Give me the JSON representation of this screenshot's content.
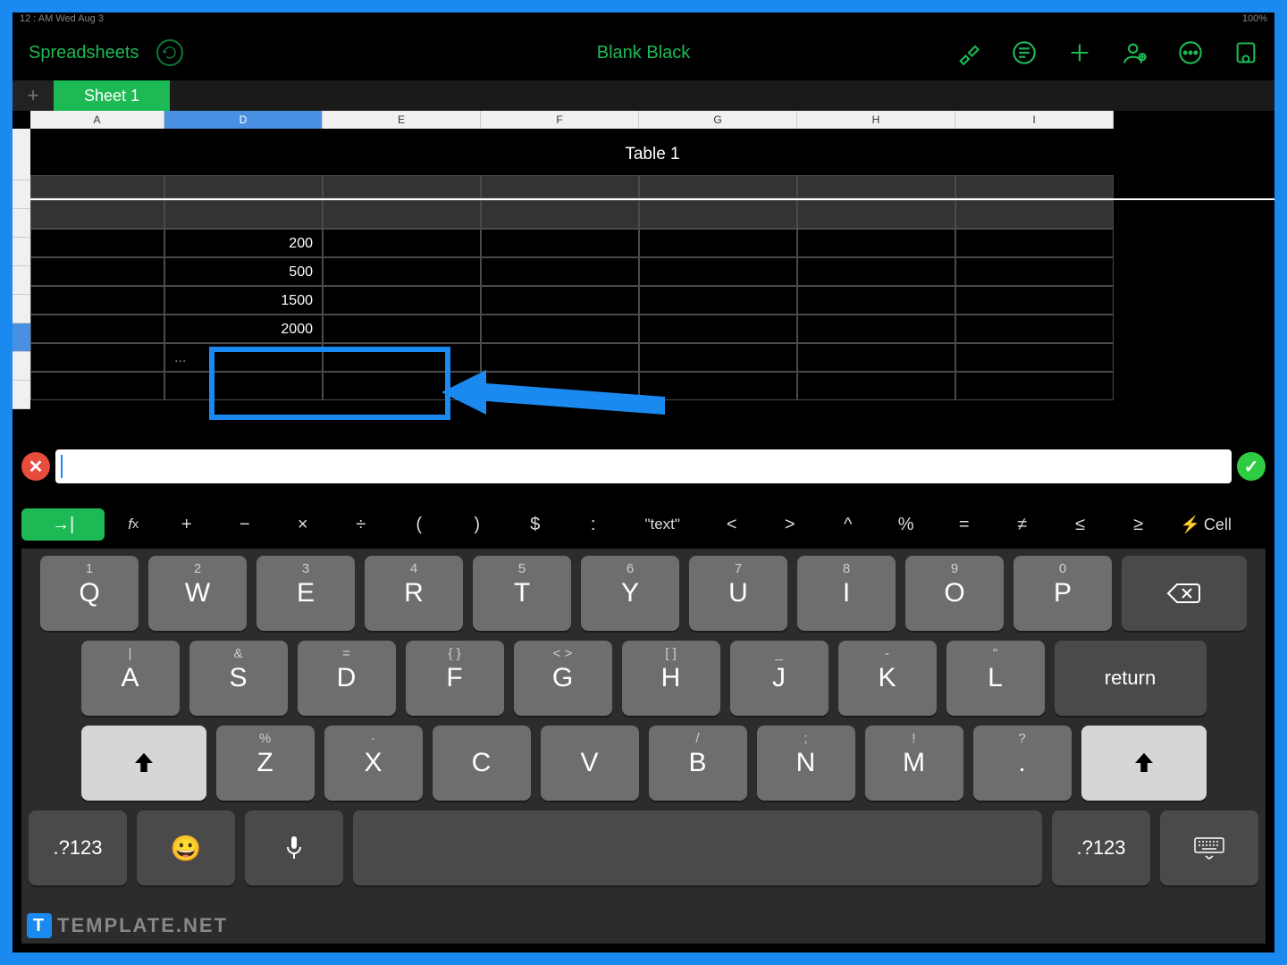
{
  "status": {
    "left": "12 : AM   Wed Aug 3",
    "right": "100%"
  },
  "toolbar": {
    "back": "Spreadsheets",
    "title": "Blank Black"
  },
  "tabs": {
    "active": "Sheet 1"
  },
  "columns": [
    "A",
    "D",
    "E",
    "F",
    "G",
    "H",
    "I"
  ],
  "selectedCol": 1,
  "selectedRow": 7,
  "table": {
    "title": "Table 1",
    "rows": [
      [
        "",
        "",
        "",
        "",
        "",
        "",
        ""
      ],
      [
        "",
        "",
        "",
        "",
        "",
        "",
        ""
      ],
      [
        "",
        "200",
        "",
        "",
        "",
        "",
        ""
      ],
      [
        "",
        "500",
        "",
        "",
        "",
        "",
        ""
      ],
      [
        "",
        "1500",
        "",
        "",
        "",
        "",
        ""
      ],
      [
        "",
        "2000",
        "",
        "",
        "",
        "",
        ""
      ],
      [
        "",
        "...",
        "",
        "",
        "",
        "",
        ""
      ],
      [
        "",
        "",
        "",
        "",
        "",
        "",
        ""
      ]
    ]
  },
  "formulaValue": "",
  "shortcuts": [
    "→|",
    "fx",
    "+",
    "−",
    "×",
    "÷",
    "(",
    ")",
    "$",
    ":",
    "\"text\"",
    "<",
    ">",
    "^",
    "%",
    "=",
    "≠",
    "≤",
    "≥"
  ],
  "shortcutCell": "⚡ Cell",
  "keyboard": {
    "row1": [
      {
        "m": "Q",
        "s": "1"
      },
      {
        "m": "W",
        "s": "2"
      },
      {
        "m": "E",
        "s": "3"
      },
      {
        "m": "R",
        "s": "4"
      },
      {
        "m": "T",
        "s": "5"
      },
      {
        "m": "Y",
        "s": "6"
      },
      {
        "m": "U",
        "s": "7"
      },
      {
        "m": "I",
        "s": "8"
      },
      {
        "m": "O",
        "s": "9"
      },
      {
        "m": "P",
        "s": "0"
      }
    ],
    "row2": [
      {
        "m": "A",
        "s": "|"
      },
      {
        "m": "S",
        "s": "&"
      },
      {
        "m": "D",
        "s": "="
      },
      {
        "m": "F",
        "s": "{  }"
      },
      {
        "m": "G",
        "s": "<  >"
      },
      {
        "m": "H",
        "s": "[  ]"
      },
      {
        "m": "J",
        "s": "_"
      },
      {
        "m": "K",
        "s": "-"
      },
      {
        "m": "L",
        "s": "\""
      }
    ],
    "row2return": "return",
    "row3": [
      {
        "m": "Z",
        "s": "%"
      },
      {
        "m": "X",
        "s": "·"
      },
      {
        "m": "C",
        "s": ""
      },
      {
        "m": "V",
        "s": ""
      },
      {
        "m": "B",
        "s": "/"
      },
      {
        "m": "N",
        "s": ";"
      },
      {
        "m": "M",
        "s": "!"
      },
      {
        "m": ".",
        "s": "?"
      }
    ],
    "numkey": ".?123"
  },
  "watermark": "TEMPLATE.NET"
}
